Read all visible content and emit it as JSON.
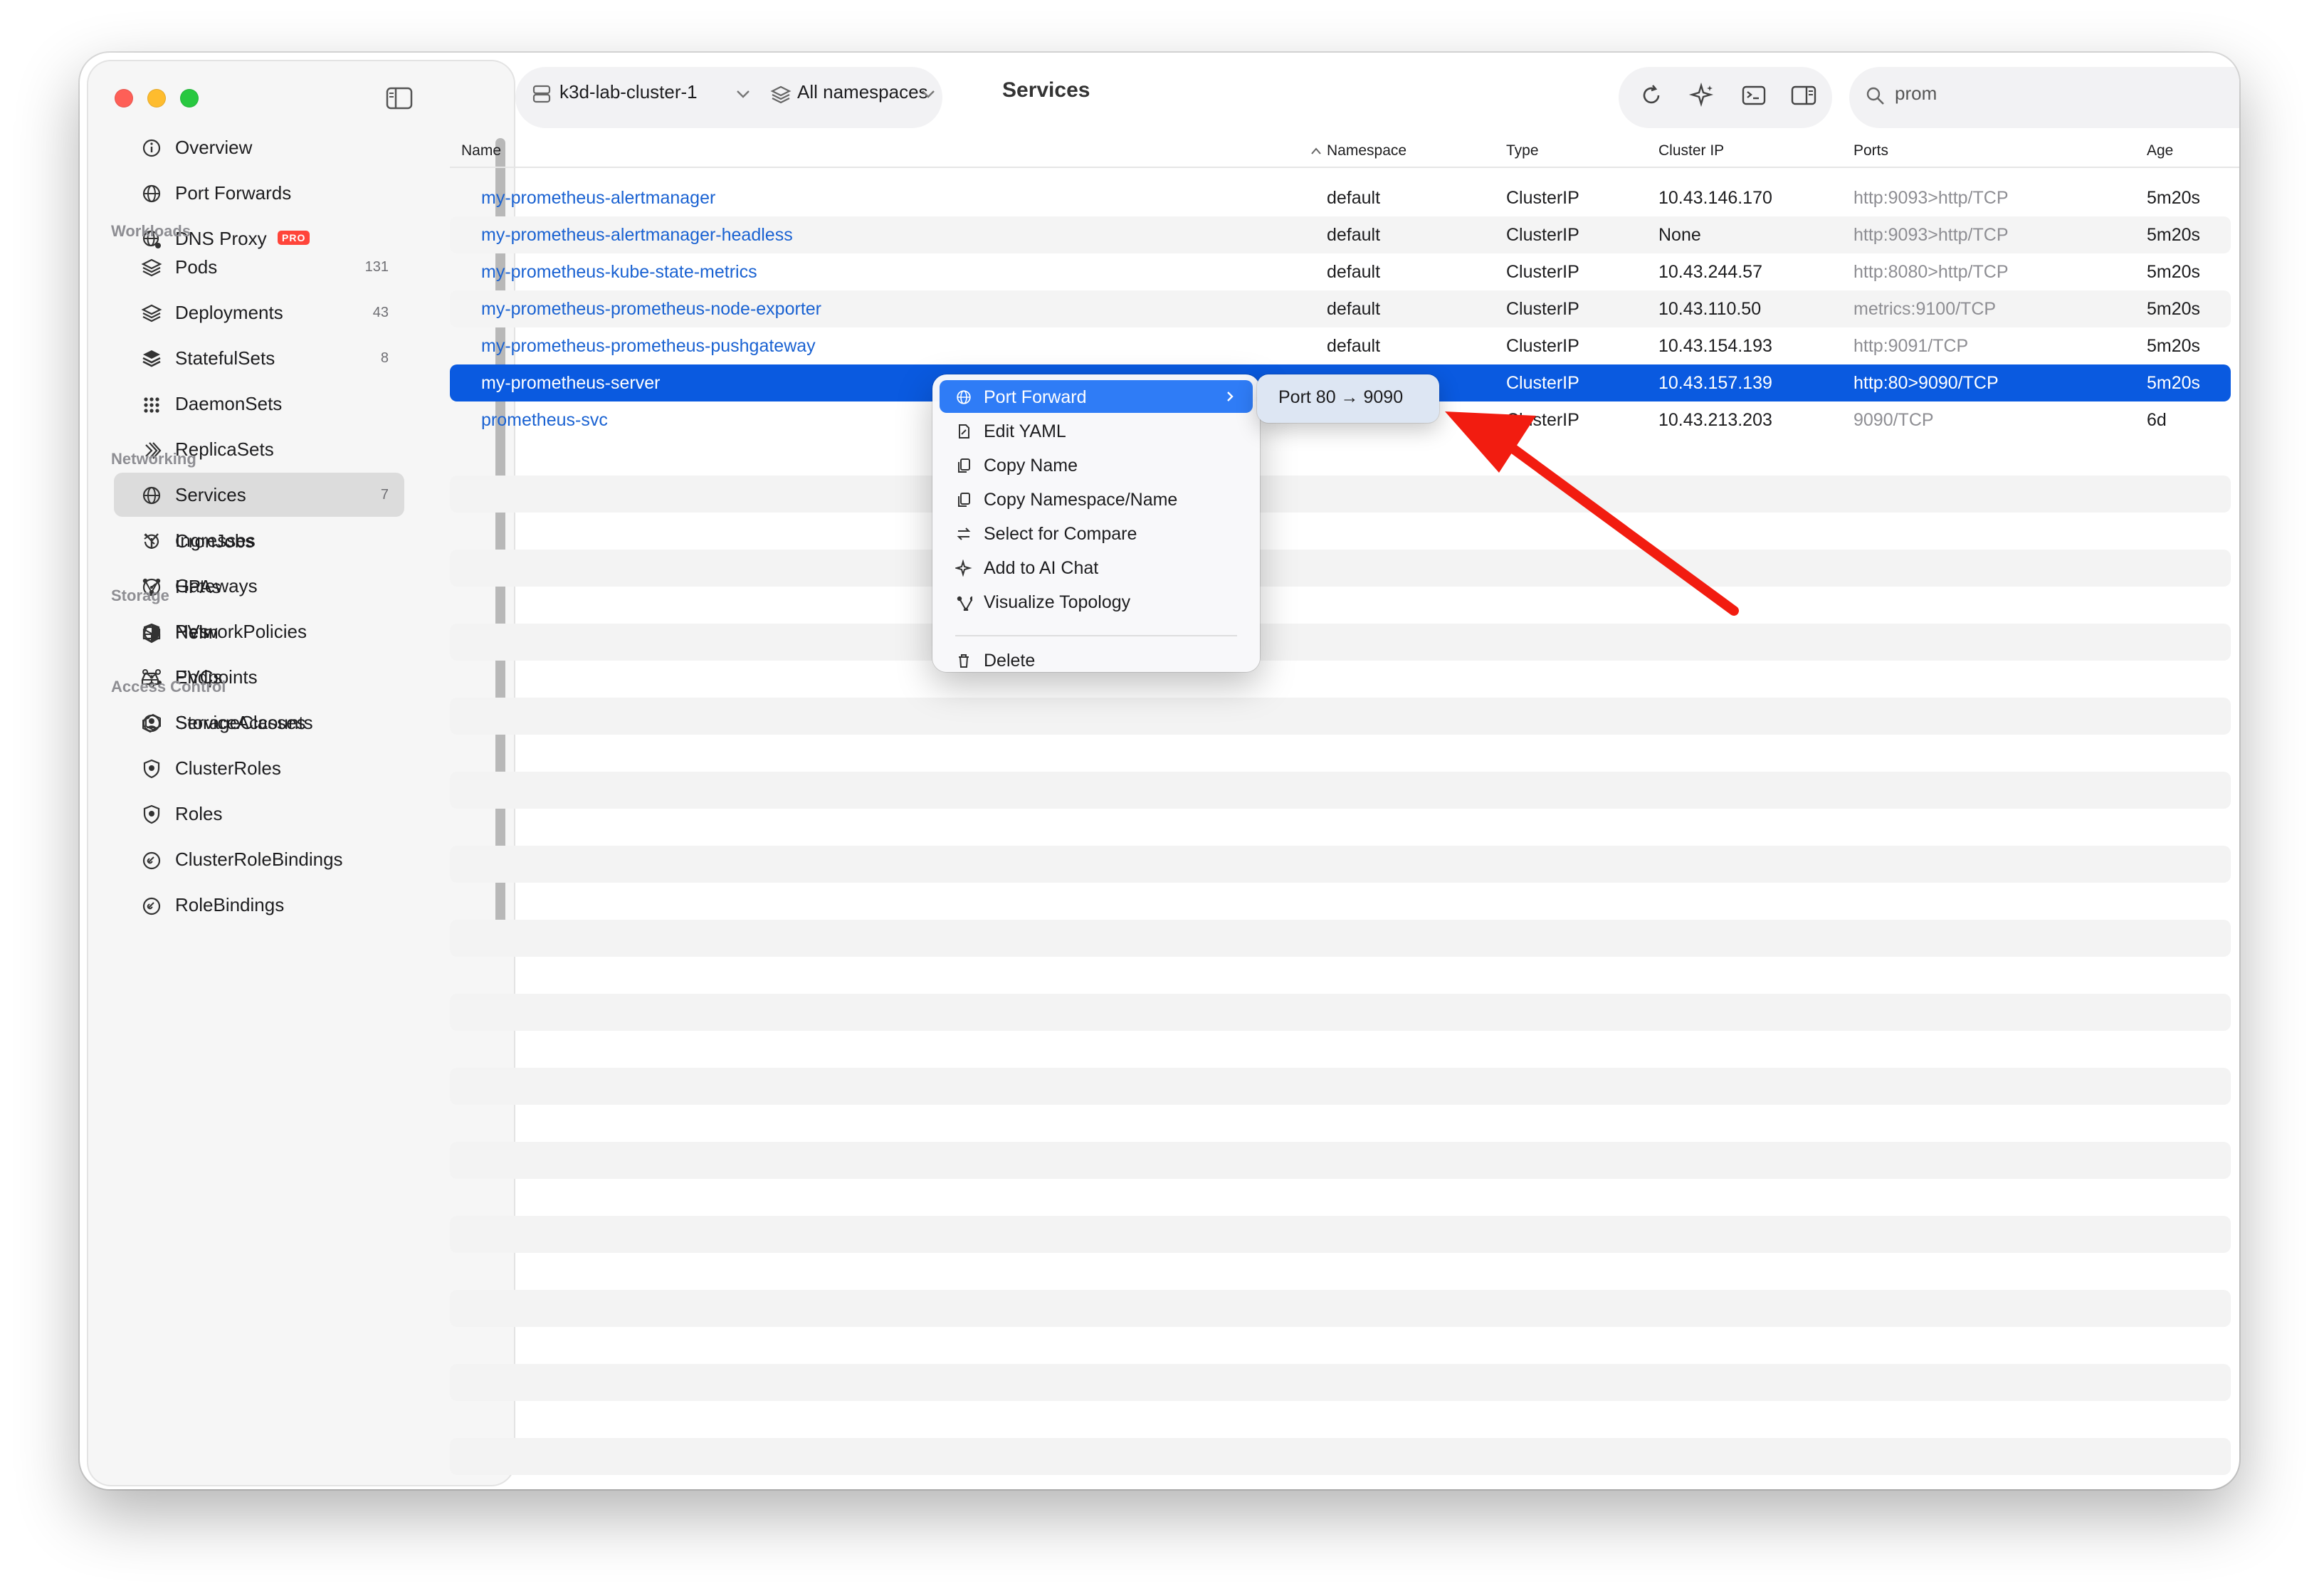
{
  "window": {
    "sidebar": {
      "sections": [
        {
          "title": "",
          "items": [
            {
              "label": "Overview",
              "icon": "info-circle-icon",
              "count": ""
            },
            {
              "label": "Port Forwards",
              "icon": "globe-icon",
              "count": ""
            },
            {
              "label": "DNS Proxy",
              "icon": "globe-network-icon",
              "count": "",
              "badge": "PRO"
            }
          ]
        },
        {
          "title": "Workloads",
          "items": [
            {
              "label": "Pods",
              "icon": "layers-icon",
              "count": "131"
            },
            {
              "label": "Deployments",
              "icon": "layers-icon",
              "count": "43"
            },
            {
              "label": "StatefulSets",
              "icon": "stack-icon",
              "count": "8"
            },
            {
              "label": "DaemonSets",
              "icon": "grid-icon",
              "count": ""
            },
            {
              "label": "ReplicaSets",
              "icon": "copies-icon",
              "count": ""
            },
            {
              "label": "Jobs",
              "icon": "gears-icon",
              "count": ""
            },
            {
              "label": "CronJobs",
              "icon": "clock-arrow-icon",
              "count": ""
            },
            {
              "label": "HPAs",
              "icon": "gauge-icon",
              "count": ""
            },
            {
              "label": "Helm",
              "icon": "cube-icon",
              "count": ""
            }
          ]
        },
        {
          "title": "Networking",
          "items": [
            {
              "label": "Services",
              "icon": "globe-icon",
              "count": "7",
              "selected": true
            },
            {
              "label": "Ingresses",
              "icon": "fork-icon",
              "count": ""
            },
            {
              "label": "Gateways",
              "icon": "nodes-icon",
              "count": ""
            },
            {
              "label": "NetworkPolicies",
              "icon": "shield-icon",
              "count": ""
            },
            {
              "label": "Endpoints",
              "icon": "network-icon",
              "count": ""
            }
          ]
        },
        {
          "title": "Storage",
          "items": [
            {
              "label": "PVs",
              "icon": "drive-icon",
              "count": ""
            },
            {
              "label": "PVCs",
              "icon": "drive-link-icon",
              "count": ""
            },
            {
              "label": "StorageClasses",
              "icon": "cube-stack-icon",
              "count": ""
            }
          ]
        },
        {
          "title": "Access Control",
          "items": [
            {
              "label": "ServiceAccounts",
              "icon": "person-circle-icon",
              "count": ""
            },
            {
              "label": "ClusterRoles",
              "icon": "badge-shield-icon",
              "count": ""
            },
            {
              "label": "Roles",
              "icon": "badge-shield-icon",
              "count": ""
            },
            {
              "label": "ClusterRoleBindings",
              "icon": "link-circle-icon",
              "count": ""
            },
            {
              "label": "RoleBindings",
              "icon": "link-circle-icon",
              "count": ""
            }
          ]
        }
      ]
    },
    "toolbar": {
      "cluster": "k3d-lab-cluster-1",
      "namespace": "All namespaces",
      "title": "Services",
      "search_value": "prom"
    },
    "table": {
      "columns": [
        "Name",
        "Namespace",
        "Type",
        "Cluster IP",
        "Ports",
        "Age"
      ],
      "rows": [
        {
          "name": "my-prometheus-alertmanager",
          "namespace": "default",
          "type": "ClusterIP",
          "ip": "10.43.146.170",
          "ports": "http:9093>http/TCP",
          "age": "5m20s"
        },
        {
          "name": "my-prometheus-alertmanager-headless",
          "namespace": "default",
          "type": "ClusterIP",
          "ip": "None",
          "ports": "http:9093>http/TCP",
          "age": "5m20s"
        },
        {
          "name": "my-prometheus-kube-state-metrics",
          "namespace": "default",
          "type": "ClusterIP",
          "ip": "10.43.244.57",
          "ports": "http:8080>http/TCP",
          "age": "5m20s"
        },
        {
          "name": "my-prometheus-prometheus-node-exporter",
          "namespace": "default",
          "type": "ClusterIP",
          "ip": "10.43.110.50",
          "ports": "metrics:9100/TCP",
          "age": "5m20s"
        },
        {
          "name": "my-prometheus-prometheus-pushgateway",
          "namespace": "default",
          "type": "ClusterIP",
          "ip": "10.43.154.193",
          "ports": "http:9091/TCP",
          "age": "5m20s"
        },
        {
          "name": "my-prometheus-server",
          "namespace": "",
          "type": "ClusterIP",
          "ip": "10.43.157.139",
          "ports": "http:80>9090/TCP",
          "age": "5m20s",
          "selected": true
        },
        {
          "name": "prometheus-svc",
          "namespace": "",
          "type": "ClusterIP",
          "ip": "10.43.213.203",
          "ports": "9090/TCP",
          "age": "6d"
        }
      ]
    },
    "context_menu": {
      "items": [
        {
          "label": "Port Forward",
          "icon": "globe-icon",
          "submenu": true
        },
        {
          "label": "Edit YAML",
          "icon": "doc-edit-icon"
        },
        {
          "label": "Copy Name",
          "icon": "copy-icon"
        },
        {
          "label": "Copy Namespace/Name",
          "icon": "copy-icon"
        },
        {
          "label": "Select for Compare",
          "icon": "swap-icon"
        },
        {
          "label": "Add to AI Chat",
          "icon": "sparkle-icon"
        },
        {
          "label": "Visualize Topology",
          "icon": "nodes-icon"
        }
      ],
      "delete_label": "Delete",
      "submenu_item": "Port 80 → 9090"
    },
    "colors": {
      "accent": "#0a5ae0",
      "link": "#1a62d2",
      "annotation_arrow": "#f21c10"
    }
  }
}
